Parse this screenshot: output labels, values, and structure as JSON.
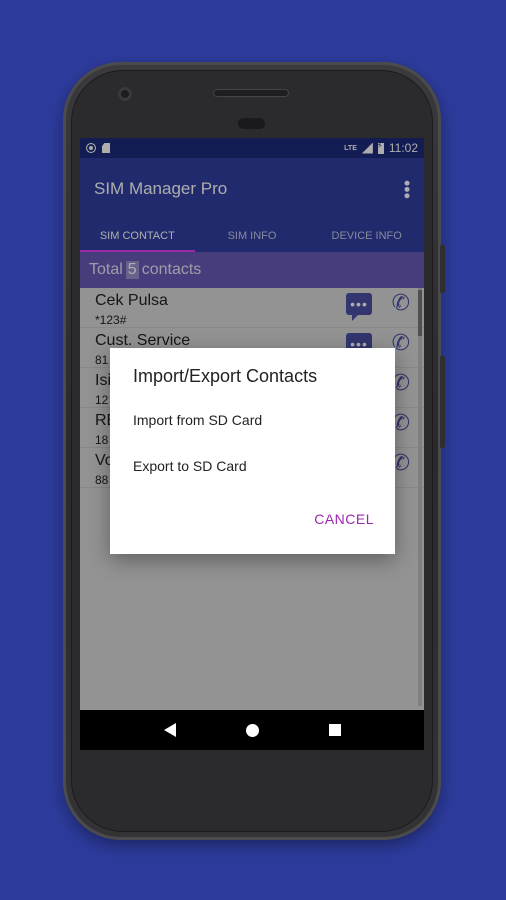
{
  "status_bar": {
    "time": "11:02",
    "network": "LTE"
  },
  "app": {
    "title": "SIM Manager Pro",
    "menu_icon": "more-vert-icon"
  },
  "tabs": [
    {
      "label": "SIM CONTACT",
      "active": true
    },
    {
      "label": "SIM INFO",
      "active": false
    },
    {
      "label": "DEVICE INFO",
      "active": false
    }
  ],
  "summary": {
    "prefix": "Total",
    "count": "5",
    "suffix": "contacts"
  },
  "contacts": [
    {
      "name": "Cek Pulsa",
      "number": "*123#"
    },
    {
      "name": "Cust. Service",
      "number": "81"
    },
    {
      "name": "Isi",
      "number": "12"
    },
    {
      "name": "RE",
      "number": "18"
    },
    {
      "name": "Vo",
      "number": "88"
    }
  ],
  "dialog": {
    "title": "Import/Export Contacts",
    "options": [
      "Import from SD Card",
      "Export to SD Card"
    ],
    "cancel_label": "CANCEL"
  },
  "colors": {
    "background": "#2d3b9c",
    "app_bar": "#303f9f",
    "accent": "#9c27b0",
    "summary_bar": "#6a5ab7",
    "action_icon": "#4b4fa2"
  }
}
